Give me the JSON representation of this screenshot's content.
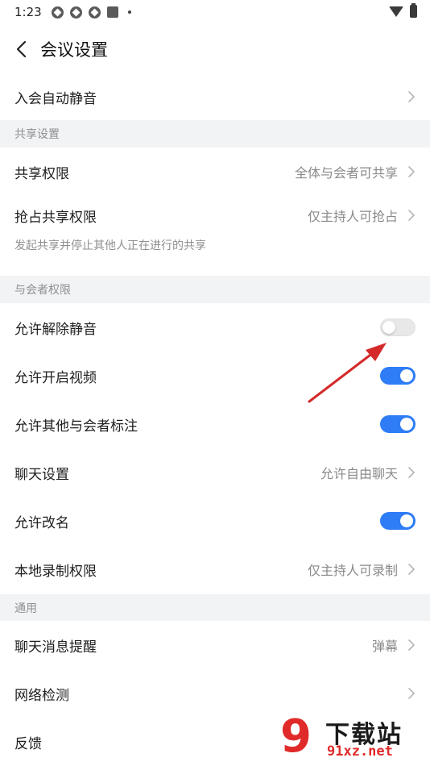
{
  "status_bar": {
    "time": "1:23"
  },
  "header": {
    "title": "会议设置"
  },
  "rows_top": [
    {
      "label": "入会自动静音"
    }
  ],
  "sections": {
    "share": "共享设置",
    "participant": "与会者权限",
    "general": "通用"
  },
  "share": {
    "permission": {
      "label": "共享权限",
      "value": "全体与会者可共享"
    },
    "grab": {
      "label": "抢占共享权限",
      "value": "仅主持人可抢占"
    },
    "hint": "发起共享并停止其他人正在进行的共享"
  },
  "participant": {
    "unmute": {
      "label": "允许解除静音",
      "on": false
    },
    "video": {
      "label": "允许开启视频",
      "on": true
    },
    "annotate": {
      "label": "允许其他与会者标注",
      "on": true
    },
    "chat": {
      "label": "聊天设置",
      "value": "允许自由聊天"
    },
    "rename": {
      "label": "允许改名",
      "on": true
    },
    "record": {
      "label": "本地录制权限",
      "value": "仅主持人可录制"
    }
  },
  "general": {
    "reminder": {
      "label": "聊天消息提醒",
      "value": "弹幕"
    },
    "network": {
      "label": "网络检测"
    },
    "feedback": {
      "label": "反馈"
    }
  },
  "colors": {
    "toggle_on": "#2e7cf6",
    "section_bg": "#f2f3f5",
    "arrow": "#d42a2a"
  },
  "watermark": {
    "title": "下载站",
    "sub": "91xz.net"
  }
}
